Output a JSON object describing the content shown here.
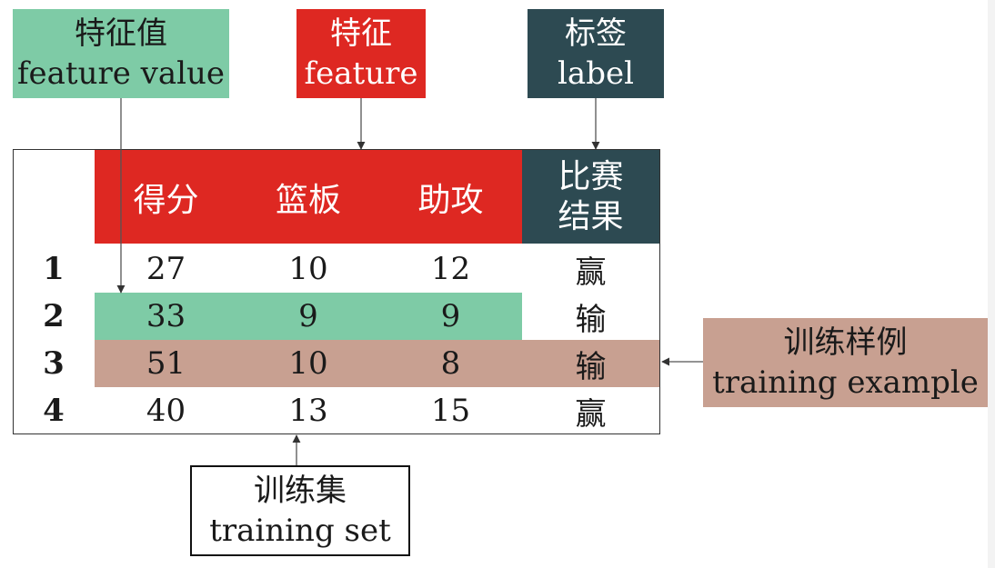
{
  "callouts": {
    "feature_value": {
      "zh": "特征值",
      "en": "feature value",
      "color": "#7ecba6"
    },
    "feature": {
      "zh": "特征",
      "en": "feature",
      "color": "#de2822"
    },
    "label": {
      "zh": "标签",
      "en": "label",
      "color": "#2d4a52"
    },
    "training_example": {
      "zh": "训练样例",
      "en": "training example",
      "color": "#c8a091"
    },
    "training_set": {
      "zh": "训练集",
      "en": "training set"
    }
  },
  "table": {
    "headers": [
      "得分",
      "篮板",
      "助攻"
    ],
    "label_header": [
      "比赛",
      "结果"
    ],
    "rows": [
      {
        "num": "1",
        "cells": [
          "27",
          "10",
          "12"
        ],
        "label": "赢"
      },
      {
        "num": "2",
        "cells": [
          "33",
          "9",
          "9"
        ],
        "label": "输"
      },
      {
        "num": "3",
        "cells": [
          "51",
          "10",
          "8"
        ],
        "label": "输"
      },
      {
        "num": "4",
        "cells": [
          "40",
          "13",
          "15"
        ],
        "label": "赢"
      }
    ]
  }
}
